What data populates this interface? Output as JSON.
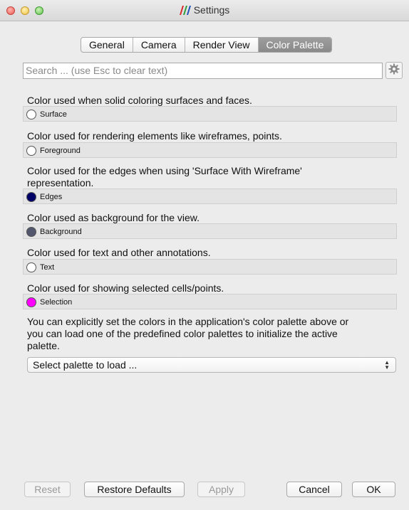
{
  "window": {
    "title": "Settings"
  },
  "tabs": [
    {
      "label": "General",
      "active": false
    },
    {
      "label": "Camera",
      "active": false
    },
    {
      "label": "Render View",
      "active": false
    },
    {
      "label": "Color Palette",
      "active": true
    }
  ],
  "search": {
    "placeholder": "Search ... (use Esc to clear text)",
    "value": "",
    "advanced_icon": "gear-icon"
  },
  "colors": [
    {
      "description": "Color used when solid coloring surfaces and faces.",
      "label": "Surface",
      "color": "#ffffff"
    },
    {
      "description": "Color used for rendering elements like wireframes, points.",
      "label": "Foreground",
      "color": "#ffffff"
    },
    {
      "description": "Color used for the edges when using 'Surface With Wireframe'",
      "description_line2": "representation.",
      "label": "Edges",
      "color": "#000066"
    },
    {
      "description": "Color used as background for the view.",
      "label": "Background",
      "color": "#52576e"
    },
    {
      "description": "Color used for text and other annotations.",
      "label": "Text",
      "color": "#ffffff"
    },
    {
      "description": "Color used for showing selected cells/points.",
      "label": "Selection",
      "color": "#ff00ff"
    }
  ],
  "palette_note": {
    "line1": "You can explicitly set the colors in the application's color palette above or",
    "line2": "you can load one of the predefined color palettes to initialize the active",
    "line3": "palette."
  },
  "palette_select": {
    "value": "Select palette to load ..."
  },
  "buttons": {
    "reset": "Reset",
    "restore_defaults": "Restore Defaults",
    "apply": "Apply",
    "cancel": "Cancel",
    "ok": "OK"
  }
}
